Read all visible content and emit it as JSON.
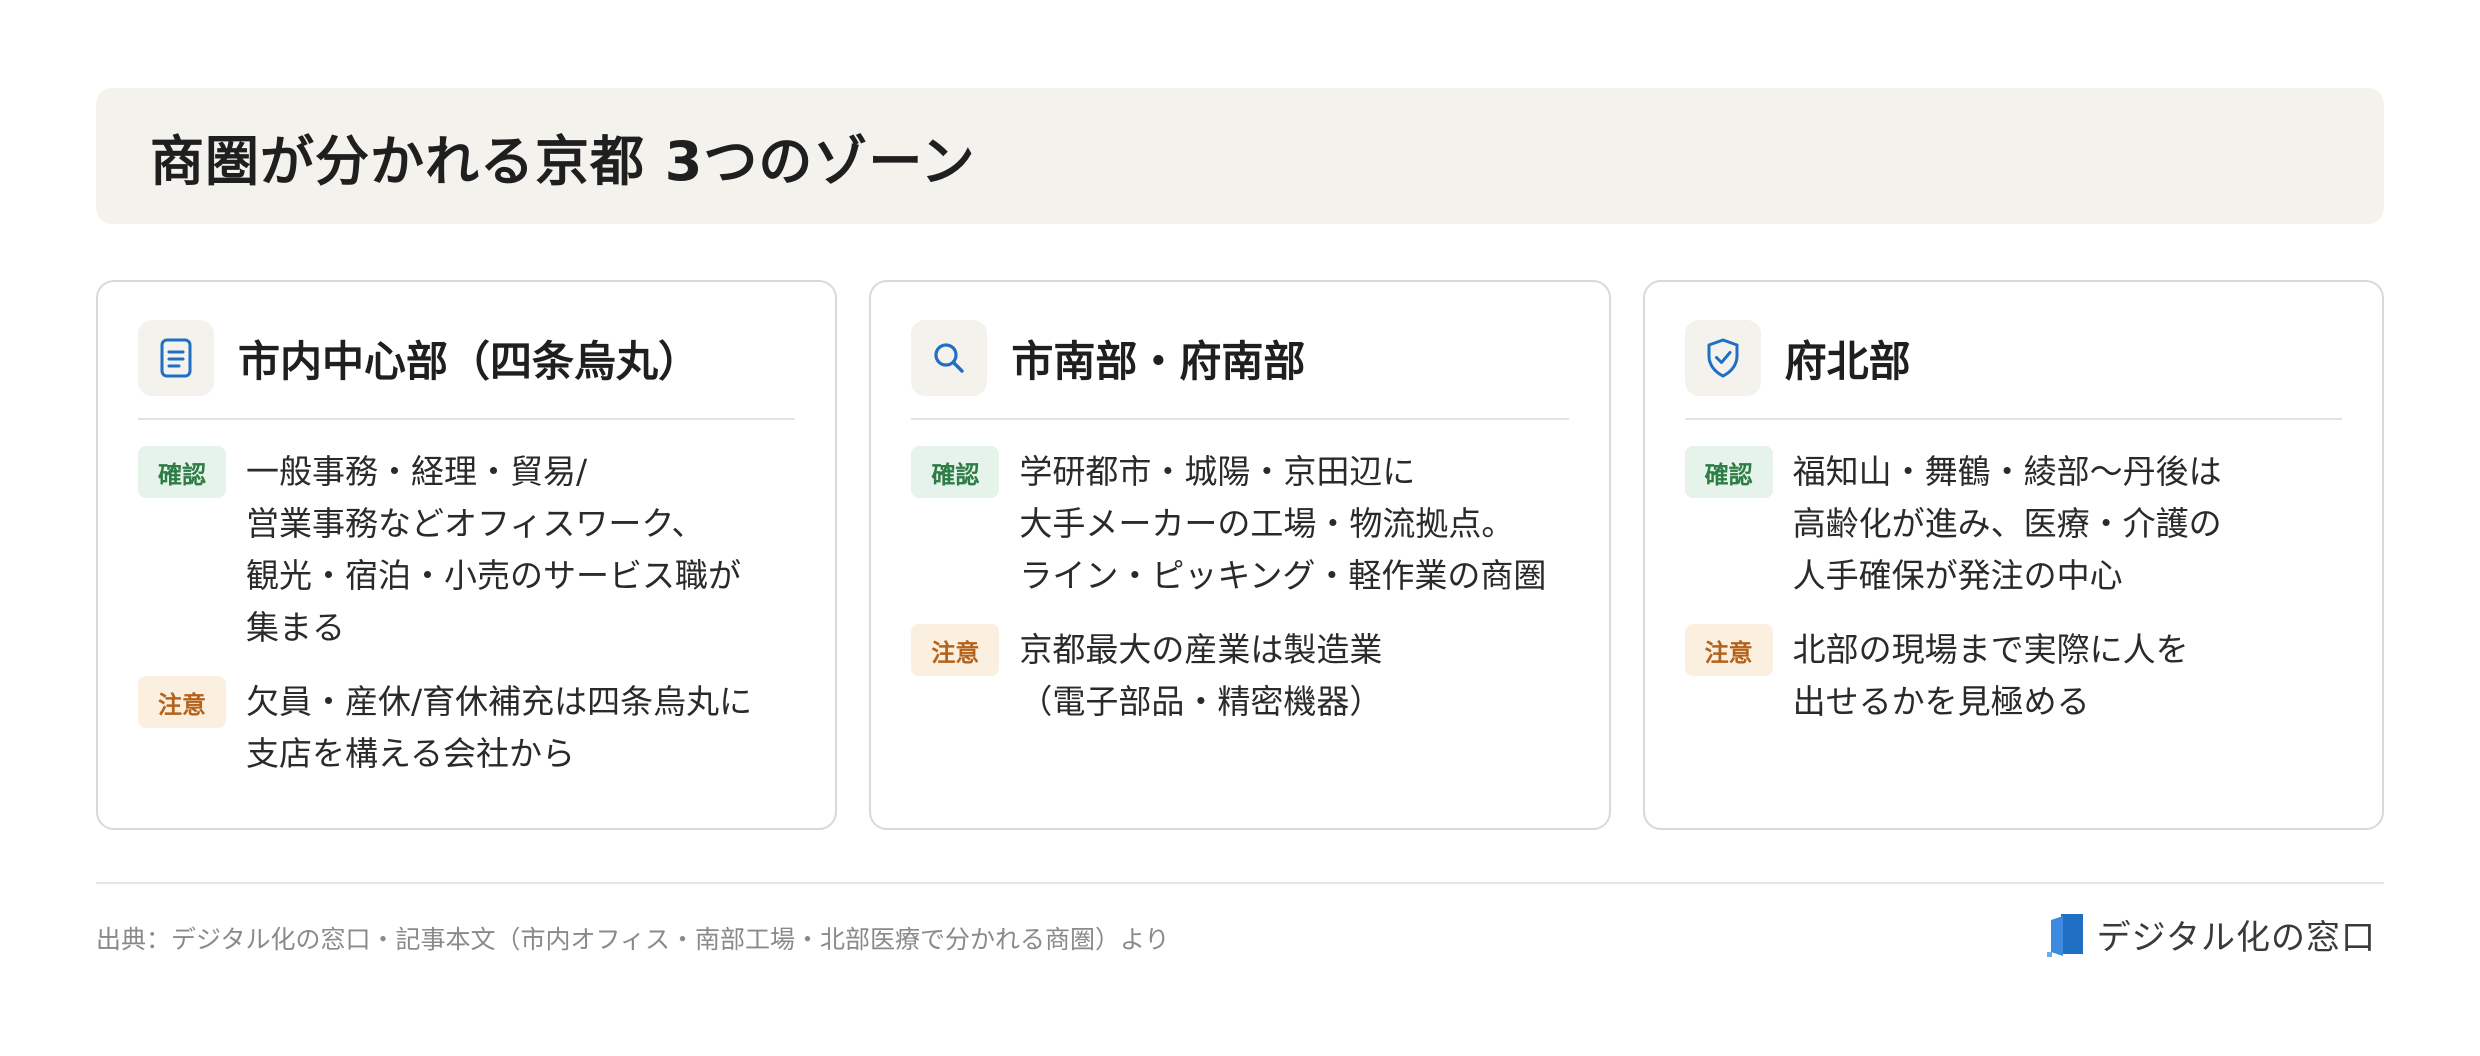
{
  "title": "商圏が分かれる京都 3つのゾーン",
  "cards": [
    {
      "icon": "document-icon",
      "title": "市内中心部（四条烏丸）",
      "confirm_label": "確認",
      "confirm_lines": [
        "一般事務・経理・貿易/",
        "営業事務などオフィスワーク、",
        "観光・宿泊・小売のサービス職が",
        "集まる"
      ],
      "caution_label": "注意",
      "caution_lines": [
        "欠員・産休/育休補充は四条烏丸に",
        "支店を構える会社から"
      ]
    },
    {
      "icon": "search-icon",
      "title": "市南部・府南部",
      "confirm_label": "確認",
      "confirm_lines": [
        "学研都市・城陽・京田辺に",
        "大手メーカーの工場・物流拠点。",
        "ライン・ピッキング・軽作業の商圏"
      ],
      "caution_label": "注意",
      "caution_lines": [
        "京都最大の産業は製造業",
        "（電子部品・精密機器）"
      ]
    },
    {
      "icon": "shield-check-icon",
      "title": "府北部",
      "confirm_label": "確認",
      "confirm_lines": [
        "福知山・舞鶴・綾部〜丹後は",
        "高齢化が進み、医療・介護の",
        "人手確保が発注の中心"
      ],
      "caution_label": "注意",
      "caution_lines": [
        "北部の現場まで実際に人を",
        "出せるかを見極める"
      ]
    }
  ],
  "footer": {
    "source": "出典：デジタル化の窓口・記事本文（市内オフィス・南部工場・北部医療で分かれる商圏）より",
    "brand": "デジタル化の窓口"
  },
  "colors": {
    "banner_bg": "#f4f2ec",
    "icon_blue": "#1f6fc4",
    "confirm": "#2f7d46",
    "caution": "#b5621a"
  }
}
